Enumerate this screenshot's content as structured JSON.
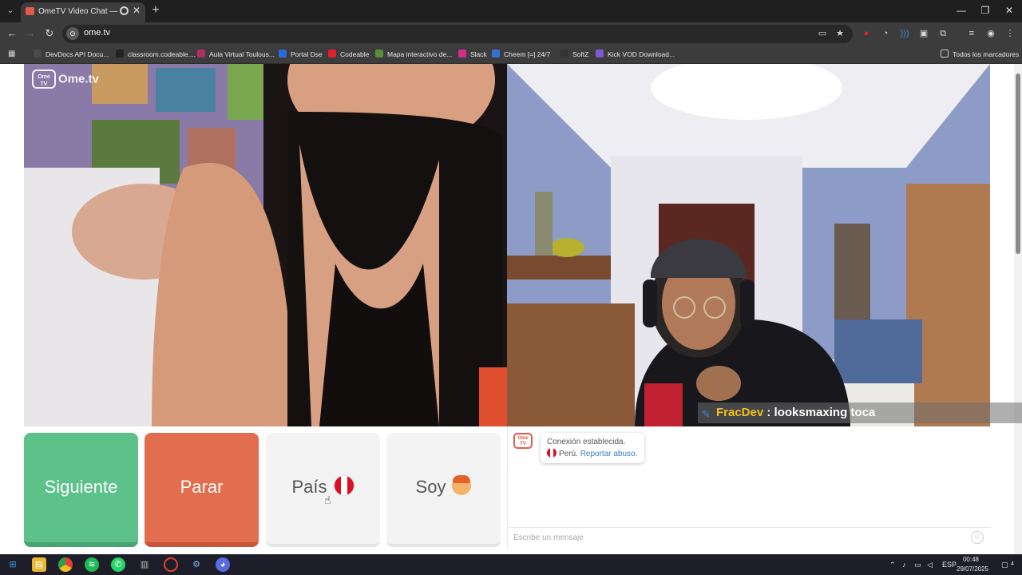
{
  "browser": {
    "tab": {
      "title": "OmeTV Video Chat — Ome",
      "close": "✕"
    },
    "new_tab": "+",
    "window_controls": {
      "minimize": "—",
      "maximize": "❐",
      "close": "✕"
    },
    "url": "ome.tv",
    "site_icon": "⊙",
    "bookmarks": [
      {
        "label": "DevDocs API Docu...",
        "color": "#4a4a4a"
      },
      {
        "label": "classroom.codeable....",
        "color": "#222222"
      },
      {
        "label": "Aula Virtual Toulous...",
        "color": "#b03060"
      },
      {
        "label": "Portal Dse",
        "color": "#2a6ad8"
      },
      {
        "label": "Codeable",
        "color": "#e02030"
      },
      {
        "label": "Mapa interactivo de...",
        "color": "#5a8a3a"
      },
      {
        "label": "Slack",
        "color": "#d0308a"
      },
      {
        "label": "Cheem [=] 24/7",
        "color": "#3a70d0"
      },
      {
        "label": "SoftZ",
        "color": "#333333"
      },
      {
        "label": "Kick VOD Download...",
        "color": "#7a5ad0"
      }
    ],
    "all_bookmarks": "Todos los marcadores"
  },
  "ometv": {
    "logo_badge": "Ome TV",
    "logo_text": "Ome.tv",
    "buttons": {
      "next": "Siguiente",
      "stop": "Parar",
      "country": "País",
      "gender": "Soy"
    },
    "chat": {
      "system_line1": "Conexión establecida.",
      "country": "Perú.",
      "report": "Reportar abuso",
      "report_suffix": ".",
      "placeholder": "Escribe un mensaje"
    }
  },
  "stream_overlay": {
    "user": "FracDev",
    "separator": ":",
    "message": "looksmaxing toca"
  },
  "taskbar": {
    "language": "ESP",
    "time": "00:48",
    "date": "29/07/2025",
    "notifications": "4"
  }
}
